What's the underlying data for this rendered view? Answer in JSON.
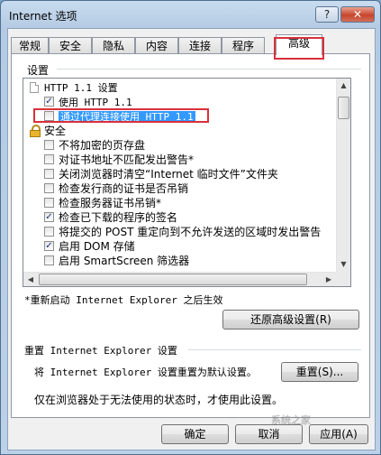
{
  "window": {
    "title": "Internet 选项",
    "help_label": "?",
    "close_label": "✕"
  },
  "tabs": [
    {
      "label": "常规"
    },
    {
      "label": "安全"
    },
    {
      "label": "隐私"
    },
    {
      "label": "内容"
    },
    {
      "label": "连接"
    },
    {
      "label": "程序"
    },
    {
      "label": "高级",
      "active": true
    }
  ],
  "settings": {
    "group_label": "设置",
    "items": [
      {
        "type": "header",
        "icon": "page-icon",
        "label": "HTTP 1.1 设置"
      },
      {
        "type": "checkbox",
        "checked": true,
        "label": "使用 HTTP 1.1"
      },
      {
        "type": "checkbox",
        "checked": false,
        "selected": true,
        "label": "通过代理连接使用 HTTP 1.1"
      },
      {
        "type": "header",
        "icon": "lock-icon",
        "label": "安全"
      },
      {
        "type": "checkbox",
        "checked": false,
        "label": "不将加密的页存盘"
      },
      {
        "type": "checkbox",
        "checked": false,
        "label": "对证书地址不匹配发出警告*"
      },
      {
        "type": "checkbox",
        "checked": false,
        "label": "关闭浏览器时清空“Internet 临时文件”文件夹"
      },
      {
        "type": "checkbox",
        "checked": false,
        "label": "检查发行商的证书是否吊销"
      },
      {
        "type": "checkbox",
        "checked": false,
        "label": "检查服务器证书吊销*"
      },
      {
        "type": "checkbox",
        "checked": true,
        "label": "检查已下载的程序的签名"
      },
      {
        "type": "checkbox",
        "checked": false,
        "label": "将提交的 POST 重定向到不允许发送的区域时发出警告"
      },
      {
        "type": "checkbox",
        "checked": true,
        "label": "启用 DOM 存储"
      },
      {
        "type": "checkbox",
        "checked": false,
        "label": "启用 SmartScreen 筛选器"
      }
    ],
    "restart_note": "*重新启动 Internet Explorer 之后生效",
    "restore_button": "还原高级设置(R)"
  },
  "reset": {
    "title": "重置 Internet Explorer 设置",
    "description": "将 Internet Explorer 设置重置为默认设置。",
    "button": "重置(S)...",
    "note": "仅在浏览器处于无法使用的状态时，才使用此设置。"
  },
  "footer": {
    "ok": "确定",
    "cancel": "取消",
    "apply": "应用(A)"
  },
  "watermark": "系统之家"
}
